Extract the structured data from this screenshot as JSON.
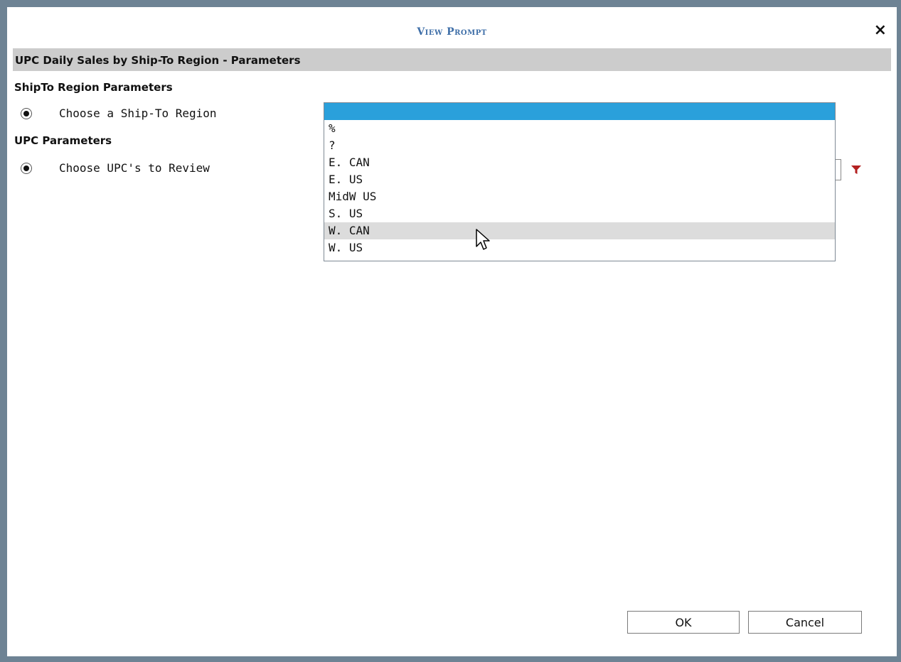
{
  "dialog": {
    "title": "View Prompt",
    "close_label": "×",
    "section_header": "UPC Daily Sales by Ship-To Region - Parameters"
  },
  "groups": {
    "shipto": {
      "label": "ShipTo Region Parameters",
      "param_label": "Choose a Ship-To Region"
    },
    "upc": {
      "label": "UPC Parameters",
      "param_label": "Choose UPC's to Review"
    }
  },
  "dropdown": {
    "selected_value": "",
    "hover_value": "W. CAN",
    "options": [
      "",
      "%",
      "?",
      "E. CAN",
      "E. US",
      "MidW US",
      "S. US",
      "W. CAN",
      "W. US"
    ]
  },
  "buttons": {
    "ok_label": "OK",
    "cancel_label": "Cancel"
  },
  "colors": {
    "title": "#3f6fa8",
    "selected_option": "#2aa0db",
    "hover_option": "#dcdcdc",
    "filter_icon": "#b32020",
    "backdrop": "#6e8394"
  },
  "icons": {
    "close": "close-icon",
    "filter": "filter-icon",
    "cursor": "mouse-pointer-icon"
  }
}
